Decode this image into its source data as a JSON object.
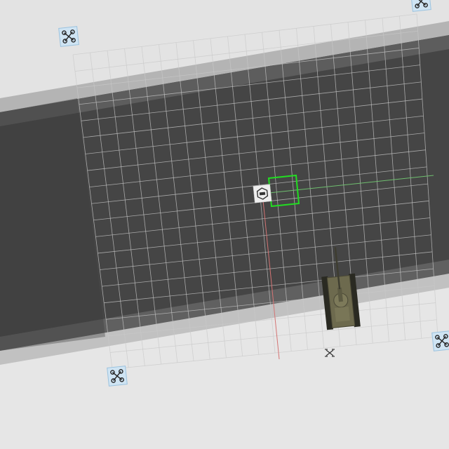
{
  "scene": {
    "kind": "top-down 3d viewport",
    "grid": {
      "columns": 20,
      "rows": 19,
      "line_color": "#c9c9c9"
    },
    "floor_colors": {
      "dark": "#454545",
      "light": "#e4e4e4",
      "void": "#333333"
    },
    "axis_colors": {
      "x_axis": "#6fbf6f",
      "y_axis": "#d47474"
    },
    "selection_color": "#22dd22",
    "corner_markers": [
      {
        "id": "corner-marker-top-left",
        "icon": "drone-icon"
      },
      {
        "id": "corner-marker-top-right",
        "icon": "drone-icon"
      },
      {
        "id": "corner-marker-bottom-left",
        "icon": "drone-icon"
      },
      {
        "id": "corner-marker-bottom-right",
        "icon": "drone-icon"
      }
    ],
    "center_marker": {
      "icon": "hexagon-emblem-icon",
      "background": "#eeeeee"
    },
    "objects": [
      {
        "name": "tank",
        "icon": "tank-icon",
        "color": "#6d6a4e"
      },
      {
        "name": "drone",
        "icon": "small-drone-icon"
      }
    ]
  }
}
